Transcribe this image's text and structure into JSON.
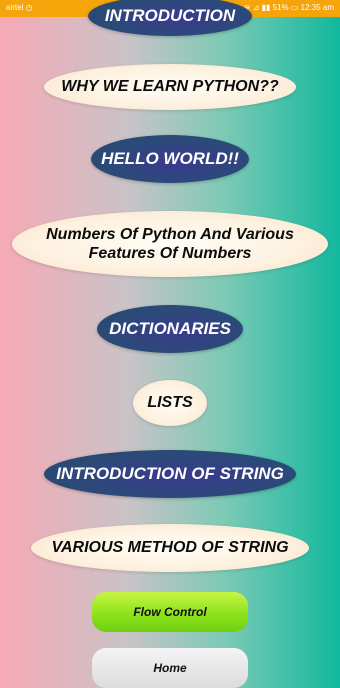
{
  "status_bar": {
    "left": "airtel ◷",
    "right": "▮◂ ≋ ⊿ ▮▮ 51% ▭ 12:35 am"
  },
  "menu": {
    "intro": "INTRODUCTION",
    "why": "WHY WE LEARN PYTHON??",
    "hello": "HELLO WORLD!!",
    "numbers": "Numbers Of Python And Various Features Of Numbers",
    "dict": "DICTIONARIES",
    "lists": "LISTS",
    "string_intro": "INTRODUCTION OF STRING",
    "string_methods": "VARIOUS METHOD OF STRING"
  },
  "buttons": {
    "flow_control": "Flow Control",
    "home": "Home"
  },
  "colors": {
    "status_bar": "#f5a40a",
    "dark_pill": "#2f3f82",
    "light_pill": "#fdf1df",
    "flow_button": "#8ee21b",
    "home_button": "#dcdcdc"
  }
}
